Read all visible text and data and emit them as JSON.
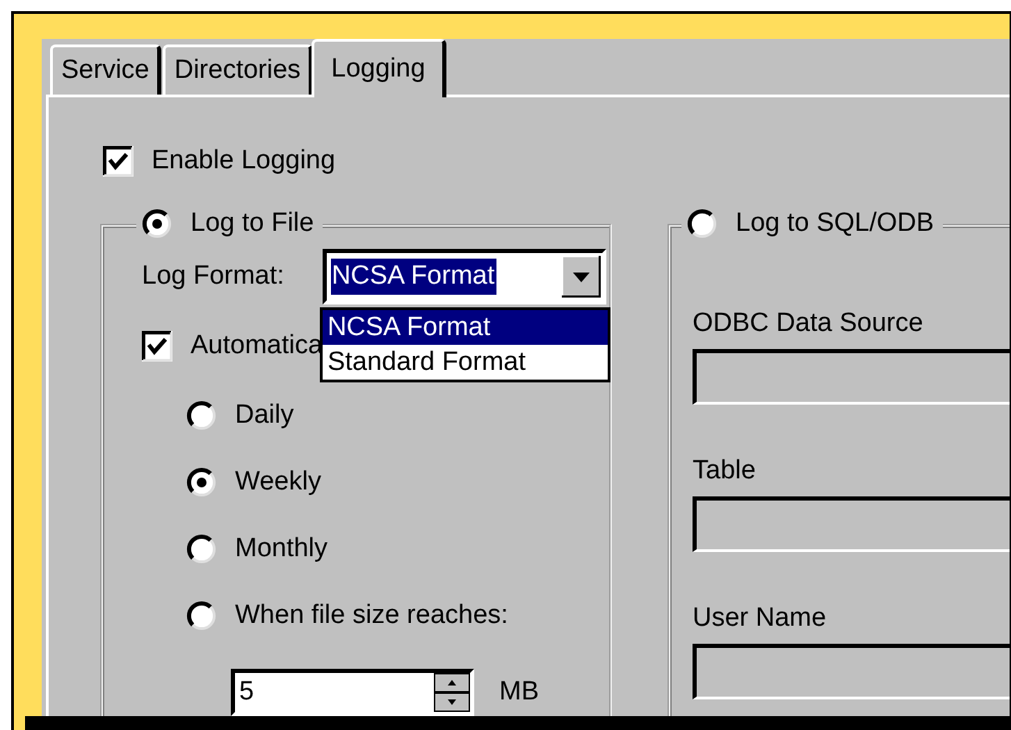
{
  "tabs": [
    {
      "label": "Service",
      "selected": false
    },
    {
      "label": "Directories",
      "selected": false
    },
    {
      "label": "Logging",
      "selected": true
    }
  ],
  "enable_logging": {
    "label": "Enable Logging",
    "checked": true
  },
  "log_to_file": {
    "label": "Log to File",
    "selected": true,
    "log_format": {
      "label": "Log Format:",
      "value": "NCSA Format",
      "expanded": true,
      "options": [
        {
          "label": "NCSA Format",
          "selected": true
        },
        {
          "label": "Standard Format",
          "selected": false
        }
      ]
    },
    "automatic": {
      "label": "Automatica",
      "checked": true
    },
    "periods": [
      {
        "label": "Daily",
        "selected": false
      },
      {
        "label": "Weekly",
        "selected": true
      },
      {
        "label": "Monthly",
        "selected": false
      },
      {
        "label": "When file size reaches:",
        "selected": false
      }
    ],
    "size": {
      "value": "5",
      "unit": "MB"
    }
  },
  "log_to_sql": {
    "label": "Log to SQL/ODB",
    "selected": false,
    "fields": [
      {
        "label": "ODBC Data Source"
      },
      {
        "label": "Table"
      },
      {
        "label": "User Name"
      }
    ]
  }
}
